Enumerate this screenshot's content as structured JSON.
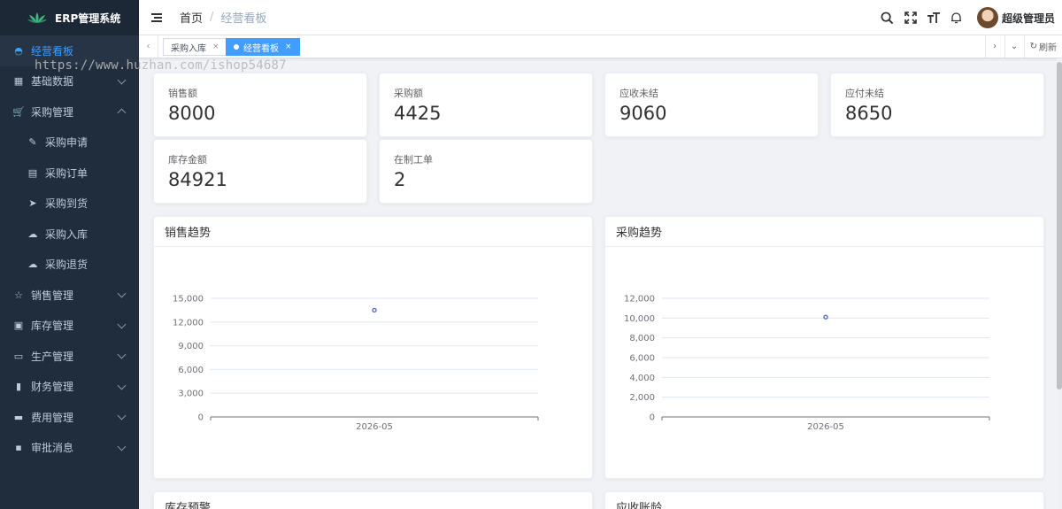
{
  "app": {
    "title": "ERP管理系统"
  },
  "sidebar": {
    "items": [
      {
        "label": "经营看板",
        "icon": "dashboard-icon",
        "active": true,
        "level": 1
      },
      {
        "label": "基础数据",
        "icon": "table-icon",
        "level": 1,
        "arrow": "down"
      },
      {
        "label": "采购管理",
        "icon": "cart-icon",
        "level": 1,
        "arrow": "up"
      },
      {
        "label": "采购申请",
        "icon": "edit-icon",
        "level": 2
      },
      {
        "label": "采购订单",
        "icon": "document-icon",
        "level": 2
      },
      {
        "label": "采购到货",
        "icon": "send-icon",
        "level": 2
      },
      {
        "label": "采购入库",
        "icon": "upload-cloud-icon",
        "level": 2
      },
      {
        "label": "采购退货",
        "icon": "download-cloud-icon",
        "level": 2
      },
      {
        "label": "销售管理",
        "icon": "star-icon",
        "level": 1,
        "arrow": "down"
      },
      {
        "label": "库存管理",
        "icon": "box-icon",
        "level": 1,
        "arrow": "down"
      },
      {
        "label": "生产管理",
        "icon": "briefcase-icon",
        "level": 1,
        "arrow": "down"
      },
      {
        "label": "财务管理",
        "icon": "book-icon",
        "level": 1,
        "arrow": "down"
      },
      {
        "label": "费用管理",
        "icon": "wallet-icon",
        "level": 1,
        "arrow": "down"
      },
      {
        "label": "审批消息",
        "icon": "message-icon",
        "level": 1,
        "arrow": "down"
      }
    ]
  },
  "navbar": {
    "breadcrumb": {
      "home": "首页",
      "separator": "/",
      "current": "经营看板"
    },
    "user": {
      "name": "超级管理员"
    }
  },
  "tags": {
    "items": [
      {
        "label": "采购入库",
        "active": false
      },
      {
        "label": "经营看板",
        "active": true
      }
    ],
    "refresh_label": "刷新"
  },
  "watermark": "https://www.huzhan.com/ishop54687",
  "stats": [
    {
      "label": "销售额",
      "value": "8000"
    },
    {
      "label": "采购额",
      "value": "4425"
    },
    {
      "label": "应收未结",
      "value": "9060"
    },
    {
      "label": "应付未结",
      "value": "8650"
    },
    {
      "label": "库存金额",
      "value": "84921"
    },
    {
      "label": "在制工单",
      "value": "2"
    }
  ],
  "panels": {
    "sales_title": "销售趋势",
    "purchase_title": "采购趋势",
    "inventory_title": "库存预警",
    "receivable_title": "应收账龄"
  },
  "colors": {
    "accent": "#409eff",
    "sidebar_bg": "#1f2d3d",
    "series": "#5470c6"
  },
  "chart_data": [
    {
      "type": "line",
      "title": "销售趋势",
      "x": [
        "2026-05"
      ],
      "series": [
        {
          "values": [
            13500
          ]
        }
      ],
      "yticks": [
        0,
        3000,
        6000,
        9000,
        12000,
        15000
      ],
      "ytick_labels": [
        "0",
        "3,000",
        "6,000",
        "9,000",
        "12,000",
        "15,000"
      ],
      "ylim": [
        0,
        15000
      ],
      "grid": true
    },
    {
      "type": "line",
      "title": "采购趋势",
      "x": [
        "2026-05"
      ],
      "series": [
        {
          "values": [
            10100
          ]
        }
      ],
      "yticks": [
        0,
        2000,
        4000,
        6000,
        8000,
        10000,
        12000
      ],
      "ytick_labels": [
        "0",
        "2,000",
        "4,000",
        "6,000",
        "8,000",
        "10,000",
        "12,000"
      ],
      "ylim": [
        0,
        12000
      ],
      "grid": true
    }
  ]
}
